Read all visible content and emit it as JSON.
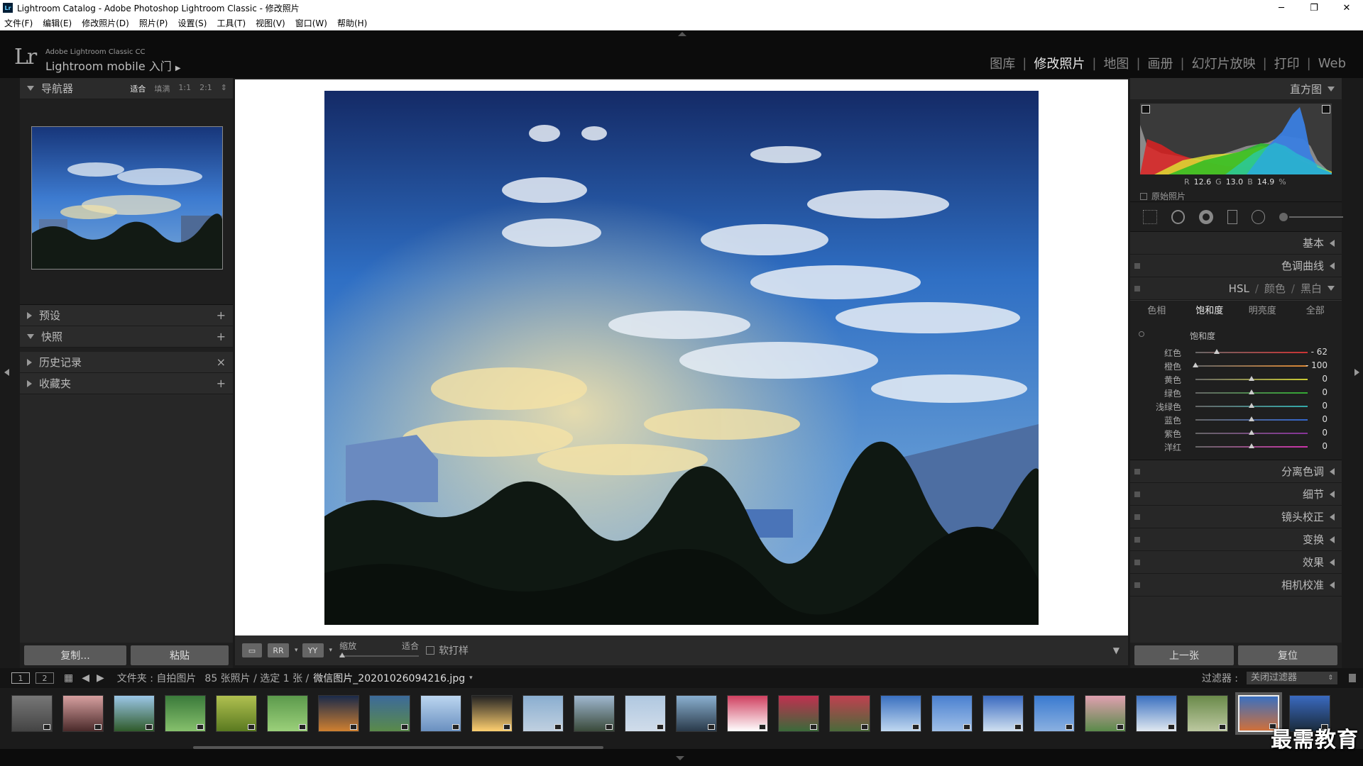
{
  "title": "Lightroom Catalog - Adobe Photoshop Lightroom Classic - 修改照片",
  "menu": [
    "文件(F)",
    "编辑(E)",
    "修改照片(D)",
    "照片(P)",
    "设置(S)",
    "工具(T)",
    "视图(V)",
    "窗口(W)",
    "帮助(H)"
  ],
  "identity": {
    "small": "Adobe Lightroom Classic CC",
    "big": "Lightroom mobile 入门"
  },
  "modules": [
    {
      "label": "图库",
      "active": false
    },
    {
      "label": "修改照片",
      "active": true
    },
    {
      "label": "地图",
      "active": false
    },
    {
      "label": "画册",
      "active": false
    },
    {
      "label": "幻灯片放映",
      "active": false
    },
    {
      "label": "打印",
      "active": false
    },
    {
      "label": "Web",
      "active": false
    }
  ],
  "left": {
    "navigator": {
      "title": "导航器",
      "modes": [
        "适合",
        "填满",
        "1:1",
        "2:1"
      ]
    },
    "panels": [
      {
        "label": "预设",
        "icon": "+"
      },
      {
        "label": "快照",
        "icon": "+"
      },
      {
        "label": "历史记录",
        "icon": "×"
      },
      {
        "label": "收藏夹",
        "icon": "+"
      }
    ],
    "copy": "复制...",
    "paste": "粘贴"
  },
  "toolbar": {
    "zoom": "缩放",
    "fit": "适合",
    "softproof": "软打样"
  },
  "right": {
    "histogram": "直方图",
    "rgb": {
      "r_label": "R",
      "r": "12.6",
      "g_label": "G",
      "g": "13.0",
      "b_label": "B",
      "b": "14.9",
      "unit": "%"
    },
    "original": "原始照片",
    "panels_top": [
      "基本",
      "色调曲线"
    ],
    "hsl_head": {
      "hsl": "HSL",
      "color": "颜色",
      "bw": "黑白"
    },
    "hsl_tabs": [
      "色相",
      "饱和度",
      "明亮度",
      "全部"
    ],
    "hsl_section": "饱和度",
    "sliders": [
      {
        "label": "红色",
        "value": "- 62",
        "pos": 0.19,
        "color": "#c33"
      },
      {
        "label": "橙色",
        "value": "- 100",
        "pos": 0.0,
        "color": "#d83"
      },
      {
        "label": "黄色",
        "value": "0",
        "pos": 0.5,
        "color": "#cc3"
      },
      {
        "label": "绿色",
        "value": "0",
        "pos": 0.5,
        "color": "#3a3"
      },
      {
        "label": "浅绿色",
        "value": "0",
        "pos": 0.5,
        "color": "#3aa"
      },
      {
        "label": "蓝色",
        "value": "0",
        "pos": 0.5,
        "color": "#36c"
      },
      {
        "label": "紫色",
        "value": "0",
        "pos": 0.5,
        "color": "#839"
      },
      {
        "label": "洋红",
        "value": "0",
        "pos": 0.5,
        "color": "#c3a"
      }
    ],
    "panels_bottom": [
      "分离色调",
      "细节",
      "镜头校正",
      "变换",
      "效果",
      "相机校准"
    ],
    "prev": "上一张",
    "reset": "复位"
  },
  "filmbar": {
    "page1": "1",
    "page2": "2",
    "folder": "文件夹 : 自拍图片",
    "count": "85 张照片 / 选定 1 张 /",
    "filename": "微信图片_20201026094216.jpg",
    "filter_label": "过滤器 :",
    "filter_value": "关闭过滤器"
  },
  "watermark": "最需教育"
}
